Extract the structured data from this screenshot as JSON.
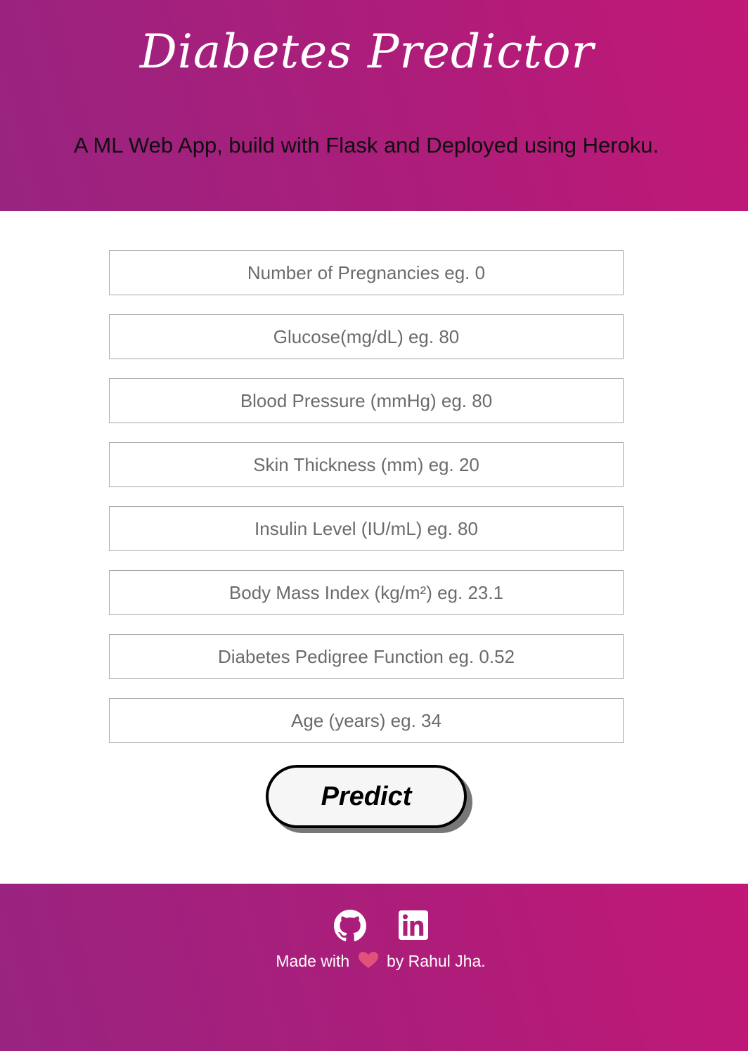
{
  "header": {
    "title": "Diabetes Predictor",
    "subtitle": "A ML Web App, build with Flask and Deployed using Heroku."
  },
  "form": {
    "fields": [
      {
        "placeholder": "Number of Pregnancies eg. 0",
        "value": ""
      },
      {
        "placeholder": "Glucose(mg/dL) eg. 80",
        "value": ""
      },
      {
        "placeholder": "Blood Pressure (mmHg) eg. 80",
        "value": ""
      },
      {
        "placeholder": "Skin Thickness (mm) eg. 20",
        "value": ""
      },
      {
        "placeholder": "Insulin Level (IU/mL) eg. 80",
        "value": ""
      },
      {
        "placeholder": "Body Mass Index (kg/m²) eg. 23.1",
        "value": ""
      },
      {
        "placeholder": "Diabetes Pedigree Function eg. 0.52",
        "value": ""
      },
      {
        "placeholder": "Age (years) eg. 34",
        "value": ""
      }
    ],
    "submit_label": "Predict"
  },
  "footer": {
    "icons": [
      "github-icon",
      "linkedin-icon"
    ],
    "made_with_prefix": "Made with",
    "made_with_suffix": "by Rahul Jha.",
    "heart_color": "#e0527a"
  },
  "colors": {
    "gradient_start": "#982480",
    "gradient_end": "#c21877",
    "field_border": "#a9a9a9",
    "placeholder_text": "#6b6b6b"
  }
}
